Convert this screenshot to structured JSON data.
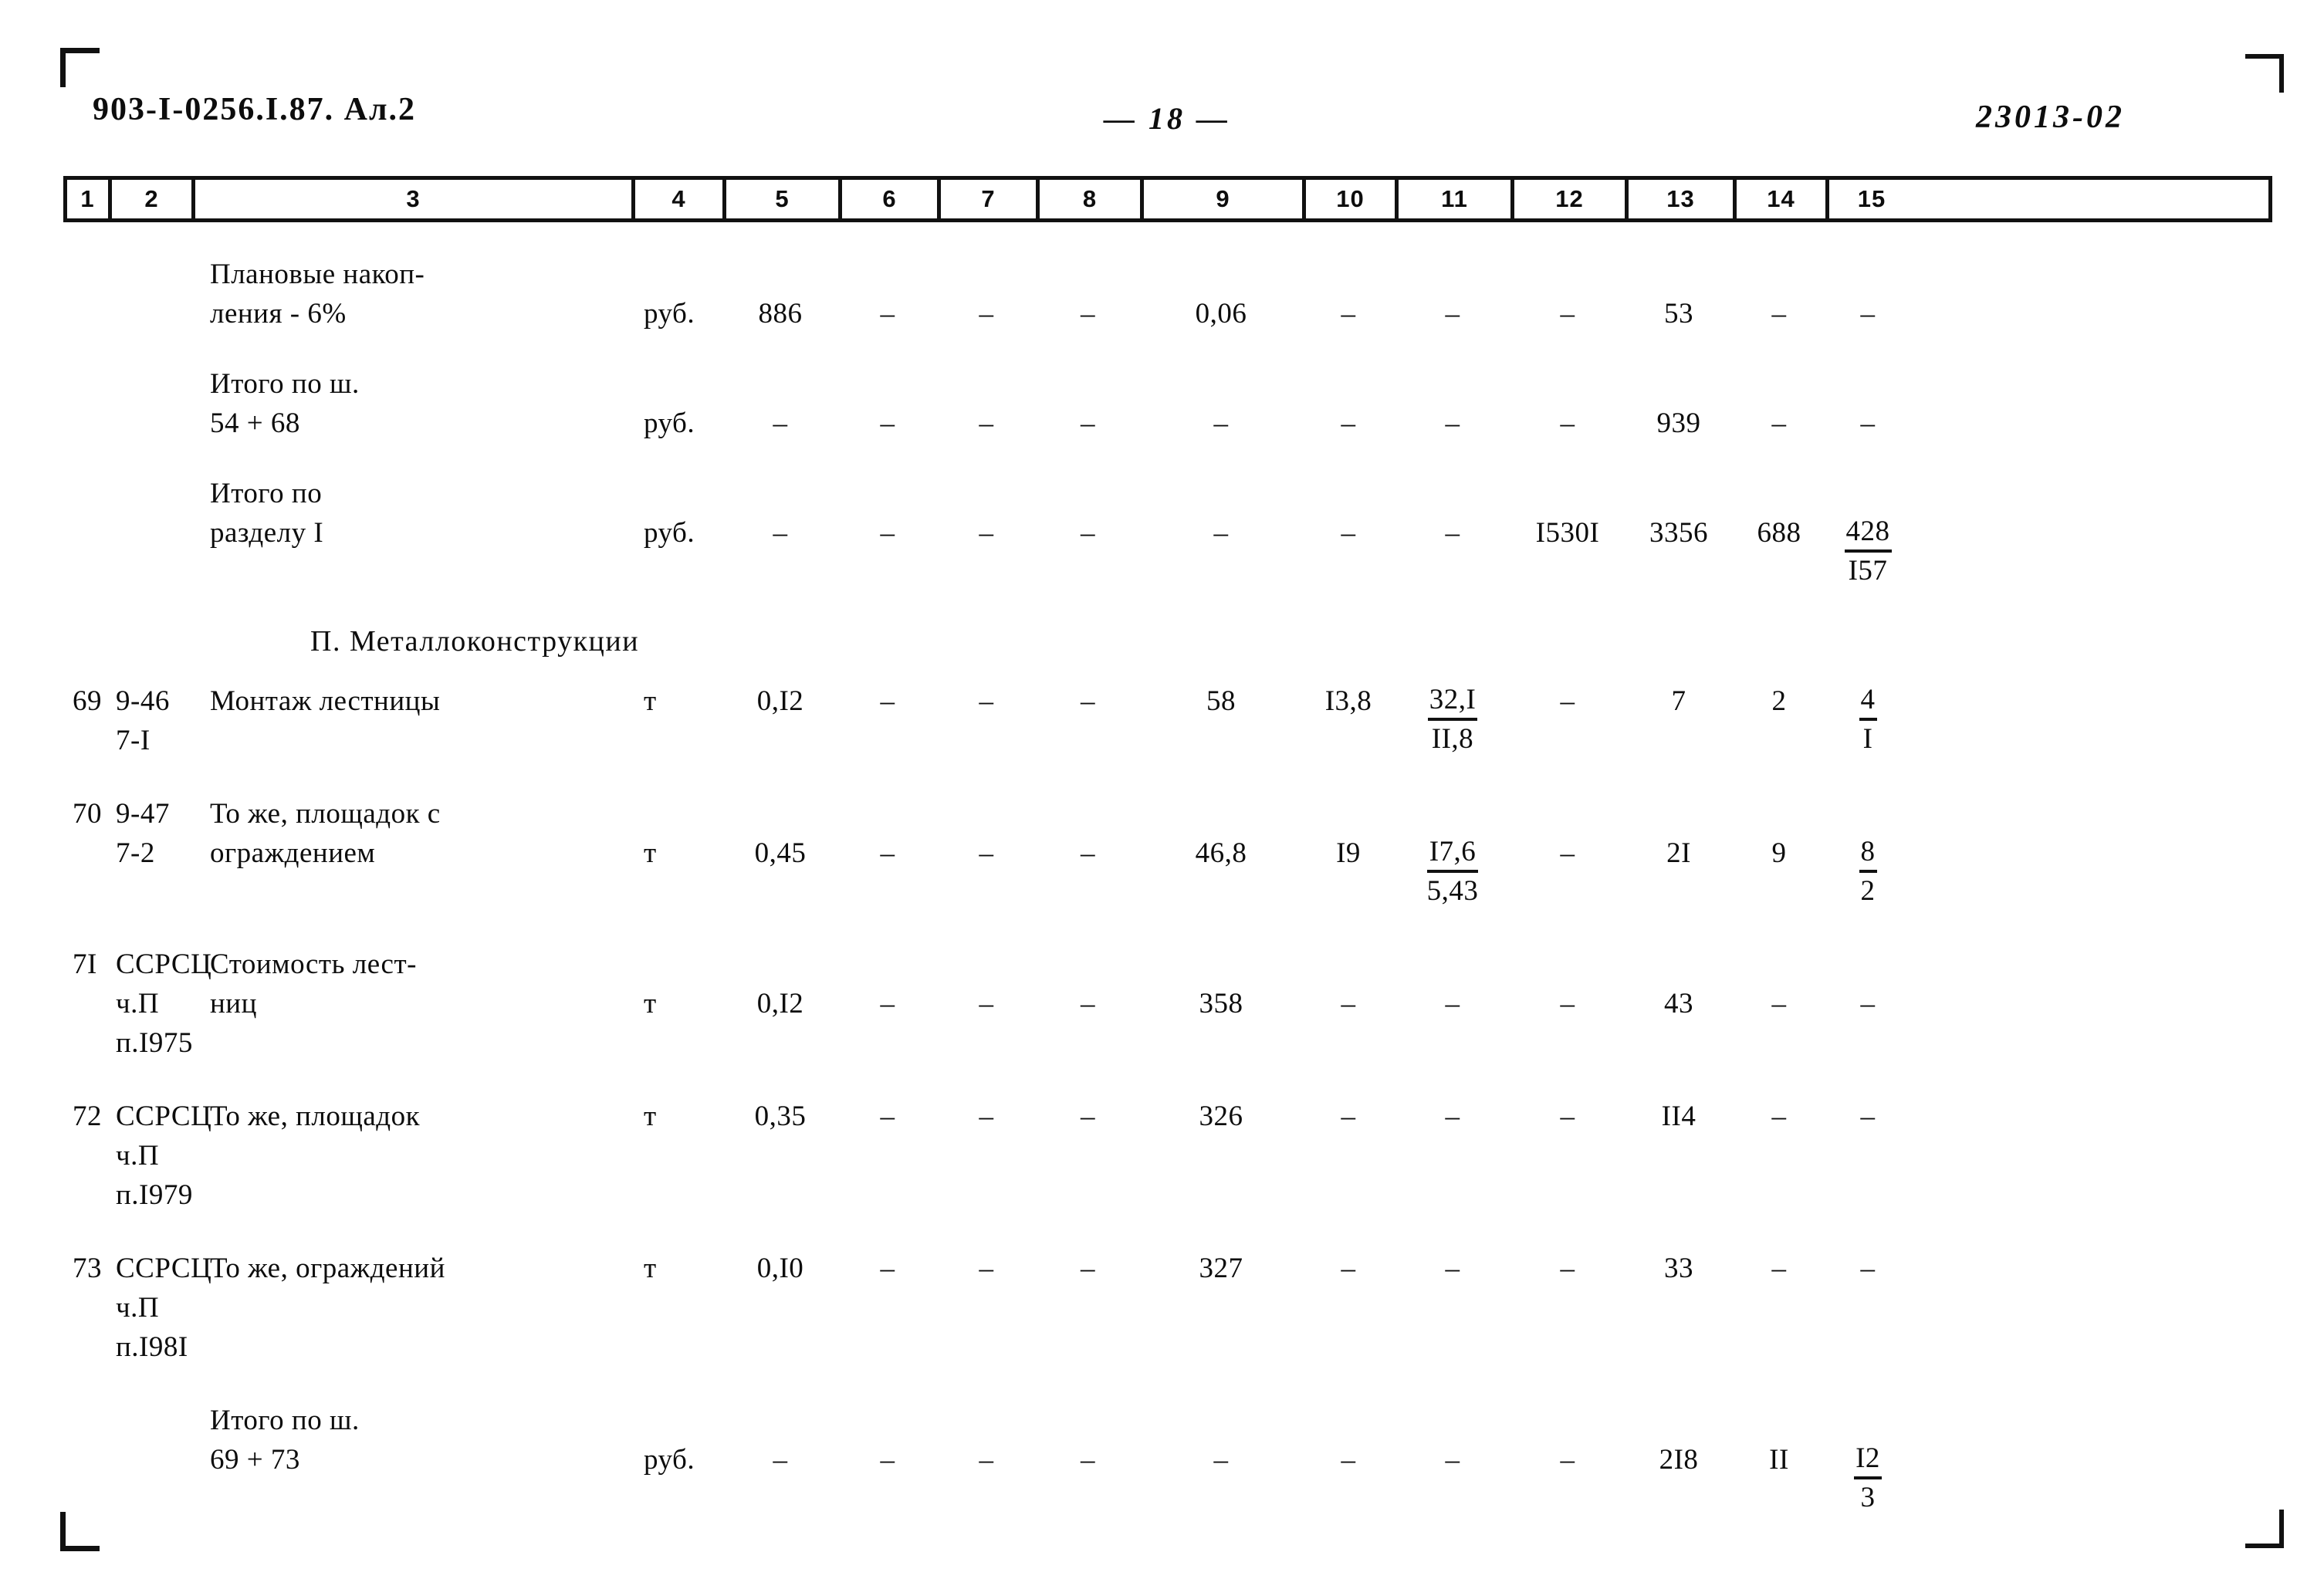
{
  "header": {
    "doc_code": "903-I-0256.I.87. Ал.2",
    "page_number": "— 18 —",
    "stamp_code": "23013-02"
  },
  "table": {
    "column_numbers": [
      "1",
      "2",
      "3",
      "4",
      "5",
      "6",
      "7",
      "8",
      "9",
      "10",
      "11",
      "12",
      "13",
      "14",
      "15"
    ],
    "rows": [
      {
        "num": "",
        "code": "",
        "desc": "Плановые накоп-\nления - 6%",
        "unit": "руб.",
        "c5": "886",
        "c6": "–",
        "c7": "–",
        "c8": "–",
        "c9": "0,06",
        "c10": "–",
        "c11": "–",
        "c12": "–",
        "c13": "53",
        "c14": "–",
        "c15": "–"
      },
      {
        "num": "",
        "code": "",
        "desc": "Итого по ш.\n54 + 68",
        "unit": "руб.",
        "c5": "–",
        "c6": "–",
        "c7": "–",
        "c8": "–",
        "c9": "–",
        "c10": "–",
        "c11": "–",
        "c12": "–",
        "c13": "939",
        "c14": "–",
        "c15": "–"
      },
      {
        "num": "",
        "code": "",
        "desc": "Итого по\nразделу I",
        "unit": "руб.",
        "c5": "–",
        "c6": "–",
        "c7": "–",
        "c8": "–",
        "c9": "–",
        "c10": "–",
        "c11": "–",
        "c12": "I530I",
        "c13": "3356",
        "c14": "688",
        "c15_top": "428",
        "c15_bot": "I57"
      }
    ],
    "section_title": "П. Металлоконструкции",
    "rows2": [
      {
        "num": "69",
        "code": "9-46\n7-I",
        "desc": "Монтаж лестницы",
        "unit": "т",
        "c5": "0,I2",
        "c6": "–",
        "c7": "–",
        "c8": "–",
        "c9": "58",
        "c10": "I3,8",
        "c11_top": "32,I",
        "c11_bot": "II,8",
        "c12": "–",
        "c13": "7",
        "c14": "2",
        "c15_top": "4",
        "c15_bot": "I"
      },
      {
        "num": "70",
        "code": "9-47\n7-2",
        "desc": "То же, площадок с\nограждением",
        "unit": "т",
        "c5": "0,45",
        "c6": "–",
        "c7": "–",
        "c8": "–",
        "c9": "46,8",
        "c10": "I9",
        "c11_top": "I7,6",
        "c11_bot": "5,43",
        "c12": "–",
        "c13": "2I",
        "c14": "9",
        "c15_top": "8",
        "c15_bot": "2"
      },
      {
        "num": "7I",
        "code": "ССРСЦ\nч.П\nп.I975",
        "desc": "Стоимость лест-\nниц",
        "unit": "т",
        "c5": "0,I2",
        "c6": "–",
        "c7": "–",
        "c8": "–",
        "c9": "358",
        "c10": "–",
        "c11": "–",
        "c12": "–",
        "c13": "43",
        "c14": "–",
        "c15": "–"
      },
      {
        "num": "72",
        "code": "ССРСЦ\nч.П\nп.I979",
        "desc": "То же, площадок",
        "unit": "т",
        "c5": "0,35",
        "c6": "–",
        "c7": "–",
        "c8": "–",
        "c9": "326",
        "c10": "–",
        "c11": "–",
        "c12": "–",
        "c13": "II4",
        "c14": "–",
        "c15": "–"
      },
      {
        "num": "73",
        "code": "ССРСЦ\nч.П\nп.I98I",
        "desc": "То же, ограждений",
        "unit": "т",
        "c5": "0,I0",
        "c6": "–",
        "c7": "–",
        "c8": "–",
        "c9": "327",
        "c10": "–",
        "c11": "–",
        "c12": "–",
        "c13": "33",
        "c14": "–",
        "c15": "–"
      },
      {
        "num": "",
        "code": "",
        "desc": "Итого по ш.\n69 + 73",
        "unit": "руб.",
        "c5": "–",
        "c6": "–",
        "c7": "–",
        "c8": "–",
        "c9": "–",
        "c10": "–",
        "c11": "–",
        "c12": "–",
        "c13": "2I8",
        "c14": "II",
        "c15_top": "I2",
        "c15_bot": "3"
      }
    ]
  }
}
